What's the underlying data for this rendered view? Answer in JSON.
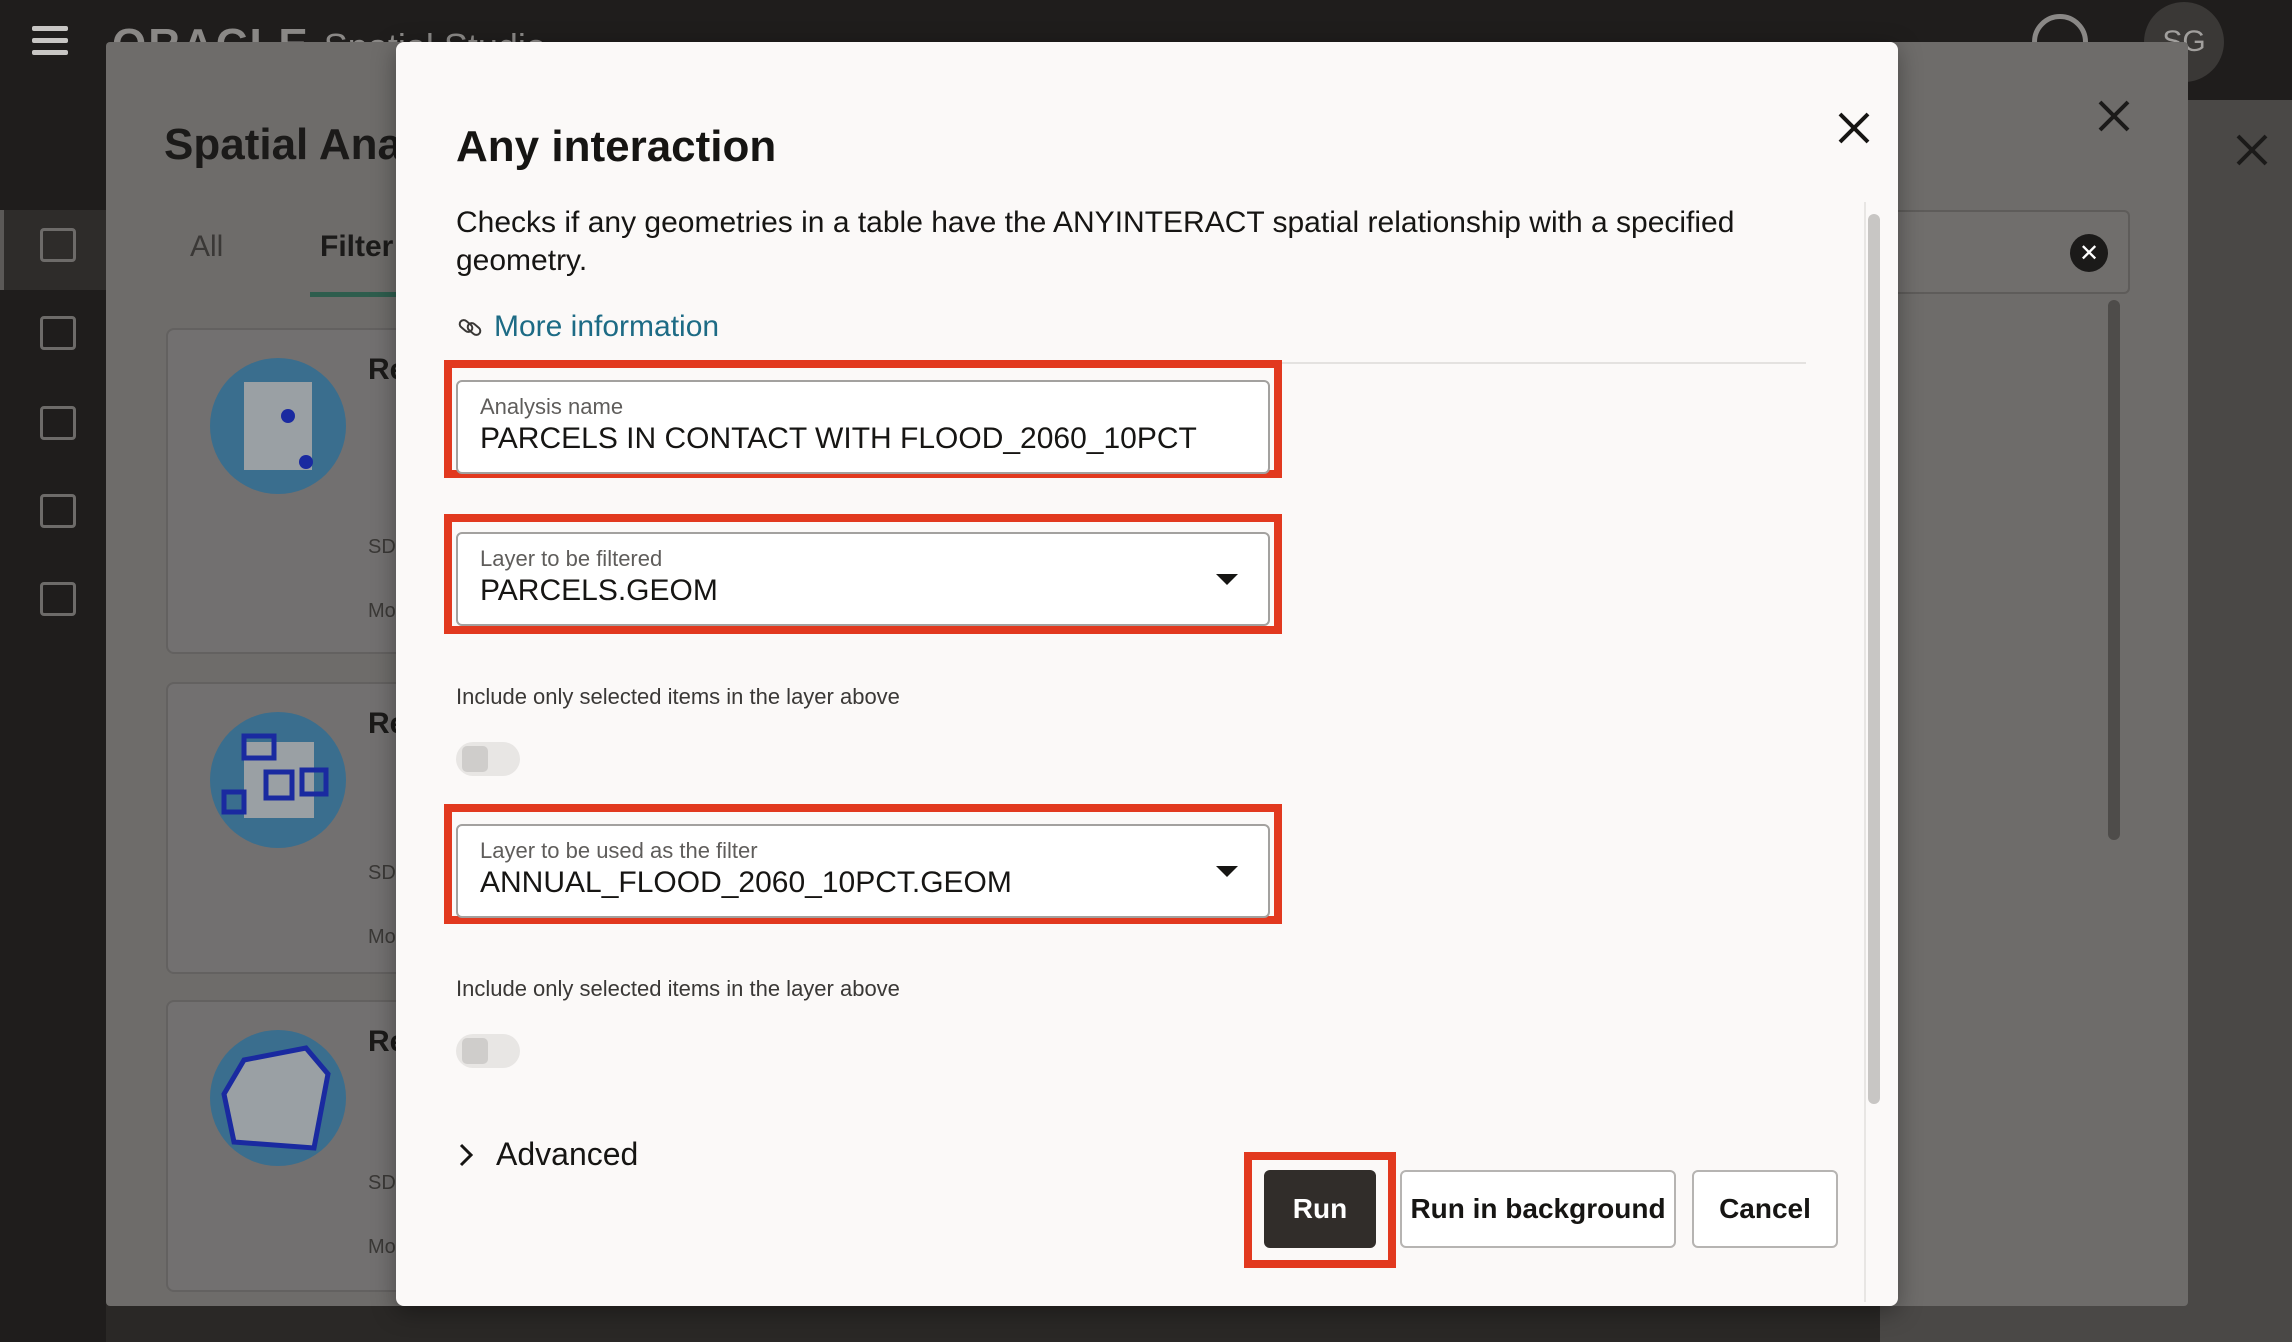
{
  "app": {
    "brand": "ORACLE",
    "product": "Spatial Studio",
    "user_initials": "SG"
  },
  "panel": {
    "title": "Spatial Ana",
    "tabs": [
      {
        "label": "All"
      },
      {
        "label": "Filter"
      }
    ],
    "cards": [
      {
        "title": "Re",
        "source": "SD",
        "more": "Mo"
      },
      {
        "title": "Re",
        "source": "SD",
        "more": "Mo"
      },
      {
        "title": "Re",
        "source": "SD",
        "more": "Mo"
      }
    ]
  },
  "modal": {
    "title": "Any interaction",
    "description": "Checks if any geometries in a table have the ANYINTERACT spatial relationship with a specified geometry.",
    "more_info": "More information",
    "analysis_name": {
      "label": "Analysis name",
      "value": "PARCELS IN CONTACT WITH FLOOD_2060_10PCT"
    },
    "layer_filtered": {
      "label": "Layer to be filtered",
      "value": "PARCELS.GEOM"
    },
    "include_selected_1": {
      "label": "Include only selected items in the layer above",
      "on": false
    },
    "layer_filter": {
      "label": "Layer to be used as the filter",
      "value": "ANNUAL_FLOOD_2060_10PCT.GEOM"
    },
    "include_selected_2": {
      "label": "Include only selected items in the layer above",
      "on": false
    },
    "advanced": "Advanced",
    "buttons": {
      "run": "Run",
      "run_background": "Run in background",
      "cancel": "Cancel"
    }
  },
  "colors": {
    "highlight": "#e2391f",
    "link": "#1d6b85",
    "primary_button": "#312d2a"
  }
}
